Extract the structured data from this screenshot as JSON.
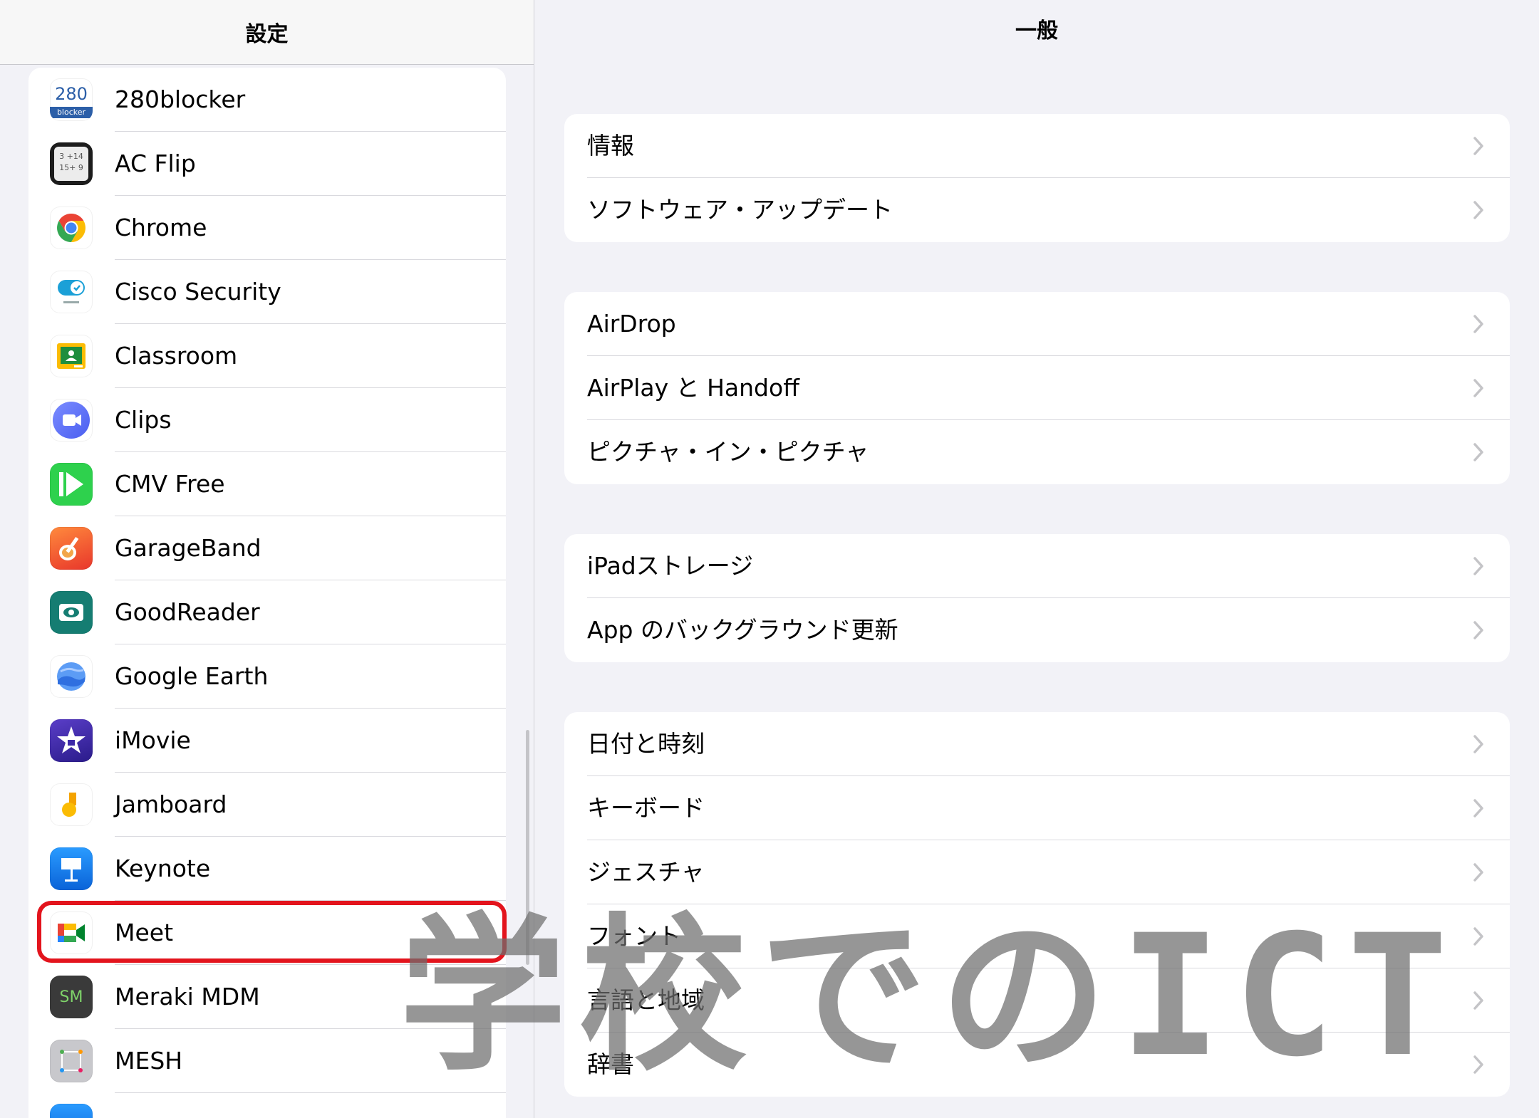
{
  "master": {
    "title": "設定",
    "apps": [
      {
        "name": "280blocker",
        "icon": "280blocker-icon"
      },
      {
        "name": "AC Flip",
        "icon": "ac-flip-icon"
      },
      {
        "name": "Chrome",
        "icon": "chrome-icon"
      },
      {
        "name": "Cisco Security",
        "icon": "cisco-security-icon"
      },
      {
        "name": "Classroom",
        "icon": "classroom-icon"
      },
      {
        "name": "Clips",
        "icon": "clips-icon"
      },
      {
        "name": "CMV Free",
        "icon": "cmv-free-icon"
      },
      {
        "name": "GarageBand",
        "icon": "garageband-icon"
      },
      {
        "name": "GoodReader",
        "icon": "goodreader-icon"
      },
      {
        "name": "Google Earth",
        "icon": "google-earth-icon"
      },
      {
        "name": "iMovie",
        "icon": "imovie-icon"
      },
      {
        "name": "Jamboard",
        "icon": "jamboard-icon"
      },
      {
        "name": "Keynote",
        "icon": "keynote-icon"
      },
      {
        "name": "Meet",
        "icon": "meet-icon"
      },
      {
        "name": "Meraki MDM",
        "icon": "meraki-mdm-icon"
      },
      {
        "name": "MESH",
        "icon": "mesh-icon"
      }
    ],
    "icon_text": {
      "blocker_number": "280",
      "blocker_sub": "blocker",
      "acflip_line1": "3 +14",
      "acflip_line2": "15+ 9",
      "meraki": "SM"
    },
    "highlighted_app": "Meet"
  },
  "detail": {
    "title": "一般",
    "groups": [
      [
        {
          "label": "情報"
        },
        {
          "label": "ソフトウェア・アップデート"
        }
      ],
      [
        {
          "label": "AirDrop"
        },
        {
          "label": "AirPlay と Handoff"
        },
        {
          "label": "ピクチャ・イン・ピクチャ"
        }
      ],
      [
        {
          "label": "iPadストレージ"
        },
        {
          "label": "App のバックグラウンド更新"
        }
      ],
      [
        {
          "label": "日付と時刻"
        },
        {
          "label": "キーボード"
        },
        {
          "label": "ジェスチャ"
        },
        {
          "label": "フォント"
        },
        {
          "label": "言語と地域"
        },
        {
          "label": "辞書"
        }
      ]
    ]
  },
  "watermark": {
    "text": "学校でのICT"
  },
  "colors": {
    "background": "#f2f2f7",
    "highlight": "#e3141d",
    "chevron": "#c4c4c7",
    "separator": "#d9d9de"
  }
}
